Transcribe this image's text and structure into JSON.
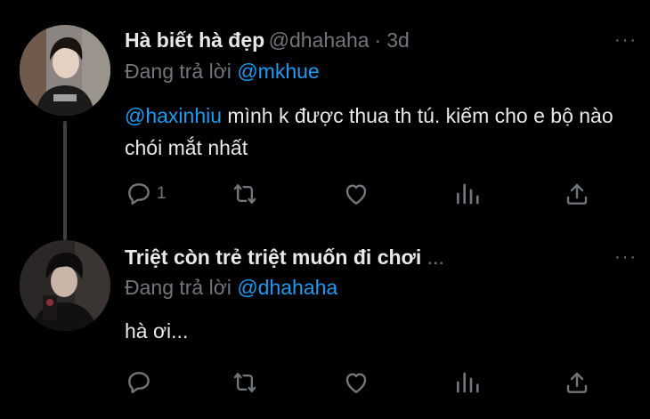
{
  "tweets": [
    {
      "author_name": "Hà biết hà đẹp",
      "handle": "@dhahaha",
      "separator": "·",
      "time": "3d",
      "more_label": "···",
      "reply_prefix": "Đang trả lời",
      "reply_to": "@mkhue",
      "body_mention": "@haxinhiu",
      "body_text": " mình k được thua th tú. kiếm cho e bộ nào chói mắt nhất",
      "reply_count": "1"
    },
    {
      "author_name": "Triệt còn trẻ triệt muốn đi chơi",
      "ellipsis": " ...",
      "more_label": "···",
      "reply_prefix": "Đang trả lời",
      "reply_to": "@dhahaha",
      "body_text": "hà ơi..."
    }
  ],
  "icons": [
    "reply-icon",
    "retweet-icon",
    "like-icon",
    "analytics-icon",
    "share-icon"
  ],
  "colors": {
    "background": "#000000",
    "primary_text": "#e7e9ea",
    "secondary_text": "#71767b",
    "link": "#1d9bf0",
    "thread_line": "#3b4045"
  }
}
